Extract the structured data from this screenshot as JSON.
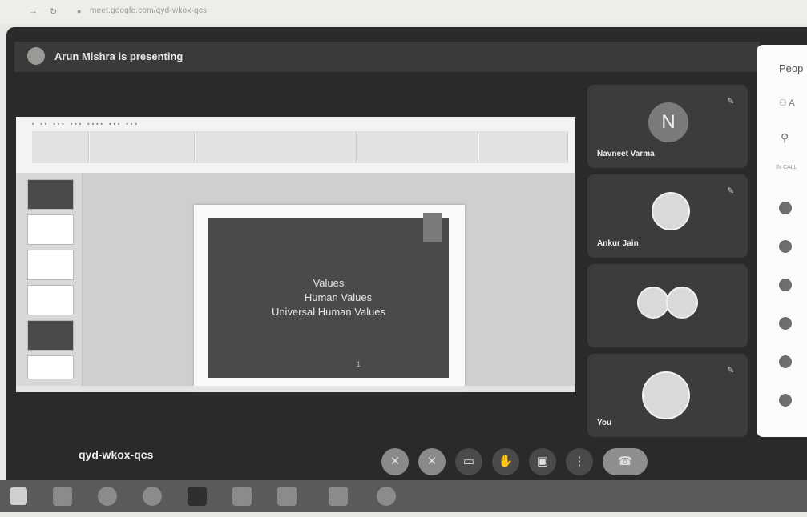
{
  "browser": {
    "url": "meet.google.com/qyd-wkox-qcs",
    "nav_back": "→",
    "nav_reload": "↻",
    "lock_icon": "●"
  },
  "banner": {
    "presenter_text": "Arun Mishra is presenting"
  },
  "slide": {
    "lines": [
      "Values",
      "Human Values",
      "Universal Human Values"
    ],
    "page_mark": "1"
  },
  "participants": [
    {
      "name": "Navneet Varma",
      "initial": "N"
    },
    {
      "name": "Ankur Jain"
    },
    {
      "name": ""
    },
    {
      "name": "You"
    }
  ],
  "people_panel": {
    "title": "Peop",
    "add_people": "A",
    "search_icon": "⚲",
    "section": "IN CALL"
  },
  "meeting": {
    "code": "qyd-wkox-qcs"
  },
  "controls": {
    "mic": "✕",
    "camera": "✕",
    "captions": "▭",
    "raise_hand": "✋",
    "present": "▣",
    "more": "⋮",
    "end_call": "☎"
  },
  "colors": {
    "meet_bg": "#2a2a2a",
    "tile_bg": "#3c3c3c",
    "end_call": "#8e8e8e"
  }
}
